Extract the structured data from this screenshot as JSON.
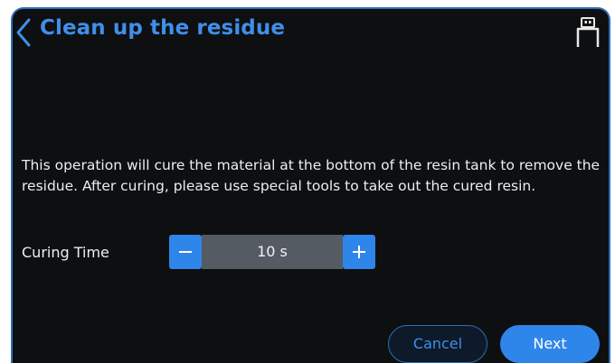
{
  "header": {
    "title": "Clean up the residue",
    "back_icon": "chevron-left-icon",
    "usb_icon": "usb-icon"
  },
  "main": {
    "description": "This operation will cure the material at the bottom of the resin tank to remove the residue. After curing, please use special tools to take out the cured resin.",
    "curing_time": {
      "label": "Curing Time",
      "value": "10 s",
      "decrement_icon": "minus-icon",
      "increment_icon": "plus-icon"
    }
  },
  "footer": {
    "cancel_label": "Cancel",
    "next_label": "Next"
  },
  "colors": {
    "accent": "#2f86ea",
    "title": "#3f8fea",
    "background": "#0e0f10",
    "stepper_value_bg": "#555b62"
  }
}
